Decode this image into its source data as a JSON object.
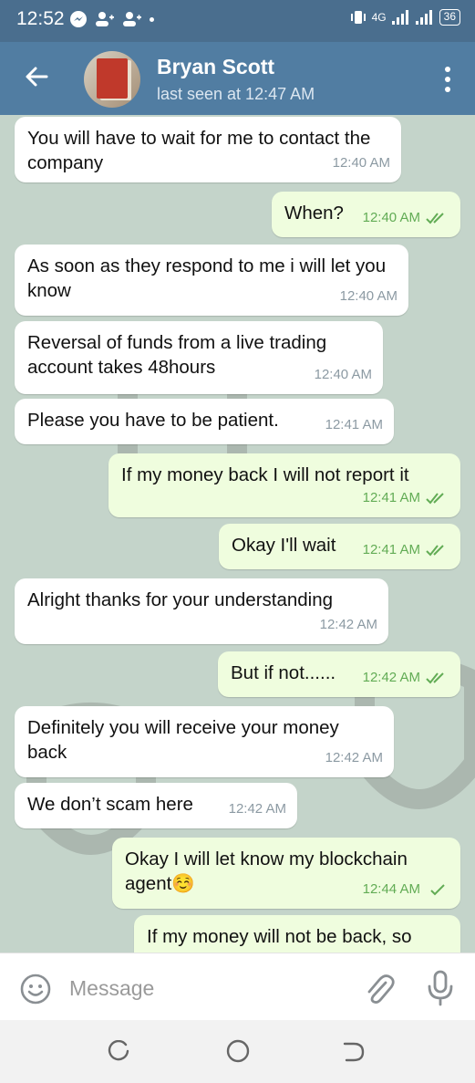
{
  "status_bar": {
    "time": "12:52",
    "network": "4G",
    "battery": "36"
  },
  "header": {
    "contact_name": "Bryan Scott",
    "last_seen": "last seen at 12:47 AM"
  },
  "messages": [
    {
      "dir": "in",
      "text": "You will have to wait for me to contact the company",
      "time": "12:40 AM"
    },
    {
      "dir": "out",
      "text": "When?",
      "time": "12:40 AM",
      "status": "read"
    },
    {
      "dir": "in",
      "text": "As soon as they respond to me i will let you know",
      "time": "12:40 AM"
    },
    {
      "dir": "in",
      "text": "Reversal of funds from a live trading account takes 48hours",
      "time": "12:40 AM"
    },
    {
      "dir": "in",
      "text": "Please you have to be patient.",
      "time": "12:41 AM"
    },
    {
      "dir": "out",
      "text": "If my money back I will not report it",
      "time": "12:41 AM",
      "status": "read"
    },
    {
      "dir": "out",
      "text": "Okay I'll wait",
      "time": "12:41 AM",
      "status": "read"
    },
    {
      "dir": "in",
      "text": "Alright thanks for your understanding",
      "time": "12:42 AM"
    },
    {
      "dir": "out",
      "text": "But if not......",
      "time": "12:42 AM",
      "status": "read"
    },
    {
      "dir": "in",
      "text": "Definitely you will receive your money back",
      "time": "12:42 AM"
    },
    {
      "dir": "in",
      "text": "We don’t scam here",
      "time": "12:42 AM"
    },
    {
      "dir": "out",
      "text": "Okay I will let know my blockchain agent☺️",
      "time": "12:44 AM",
      "status": "sent"
    },
    {
      "dir": "out",
      "text": "If my money will not be back, so",
      "time": "",
      "status": ""
    }
  ],
  "composer": {
    "placeholder": "Message"
  },
  "icons": {
    "back": "arrow-left-icon",
    "menu": "more-vertical-icon",
    "emoji": "smiley-icon",
    "attach": "paperclip-icon",
    "mic": "microphone-icon"
  },
  "colors": {
    "header": "#517da2",
    "status_bar": "#4a6e8e",
    "incoming_bubble": "#ffffff",
    "outgoing_bubble": "#effdde",
    "read_check": "#62ac55"
  }
}
